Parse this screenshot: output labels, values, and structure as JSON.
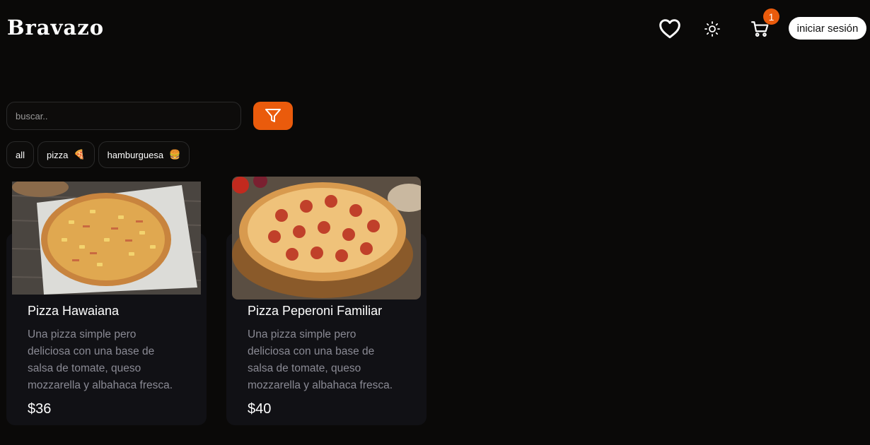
{
  "header": {
    "logo": "Bravazo",
    "cart_count": "1",
    "login_label": "iniciar sesión"
  },
  "search": {
    "placeholder": "buscar.."
  },
  "categories": [
    {
      "label": "all",
      "emoji": ""
    },
    {
      "label": "pizza",
      "emoji": "🍕"
    },
    {
      "label": "hamburguesa",
      "emoji": "🍔"
    }
  ],
  "products": [
    {
      "name": "Pizza Hawaiana",
      "description": "Una pizza simple pero deliciosa con una base de salsa de tomate, queso mozzarella y albahaca fresca.",
      "price": "$36"
    },
    {
      "name": "Pizza Peperoni Familiar",
      "description": "Una pizza simple pero deliciosa con una base de salsa de tomate, queso mozzarella y albahaca fresca.",
      "price": "$40"
    }
  ],
  "colors": {
    "accent": "#ea5b0c",
    "background": "#0a0908",
    "card": "#111115"
  },
  "icons": [
    "heart-icon",
    "sun-icon",
    "cart-icon",
    "filter-icon"
  ]
}
